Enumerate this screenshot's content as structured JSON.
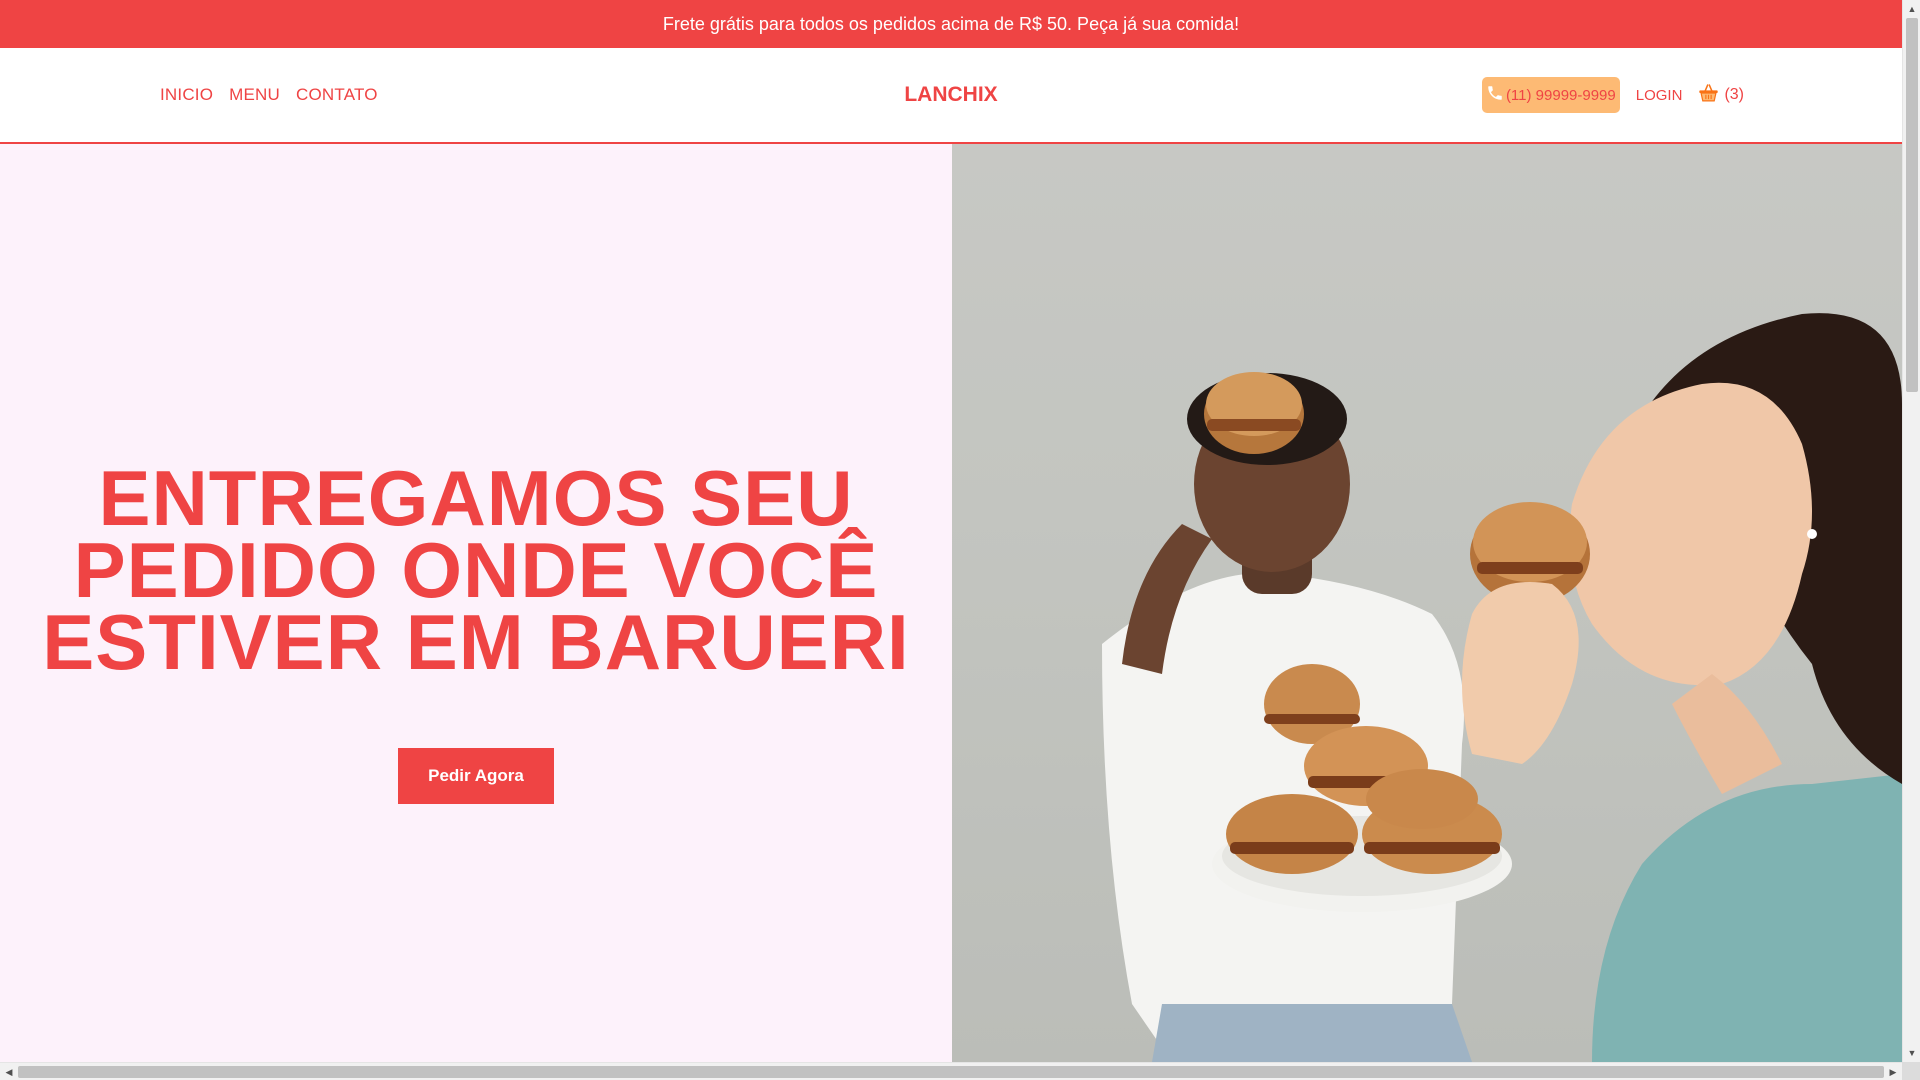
{
  "promo": {
    "text": "Frete grátis para todos os pedidos acima de R$ 50. Peça já sua comida!"
  },
  "nav": {
    "items": [
      "INICIO",
      "MENU",
      "CONTATO"
    ]
  },
  "brand": {
    "name": "LANCHIX"
  },
  "header": {
    "phone": "(11) 99999-9999",
    "login": "LOGIN",
    "cart_count": "(3)"
  },
  "hero": {
    "title_lines": [
      "ENTREGAMOS SEU",
      "PEDIDO ONDE VOCÊ",
      "ESTIVER EM BARUERI"
    ],
    "cta": "Pedir Agora"
  },
  "icons": {
    "phone": "phone-icon",
    "cart": "shopping-basket-icon"
  },
  "colors": {
    "accent": "#ef4444",
    "hero_bg": "#fdf2fb",
    "phone_pill": "#fdba74"
  }
}
